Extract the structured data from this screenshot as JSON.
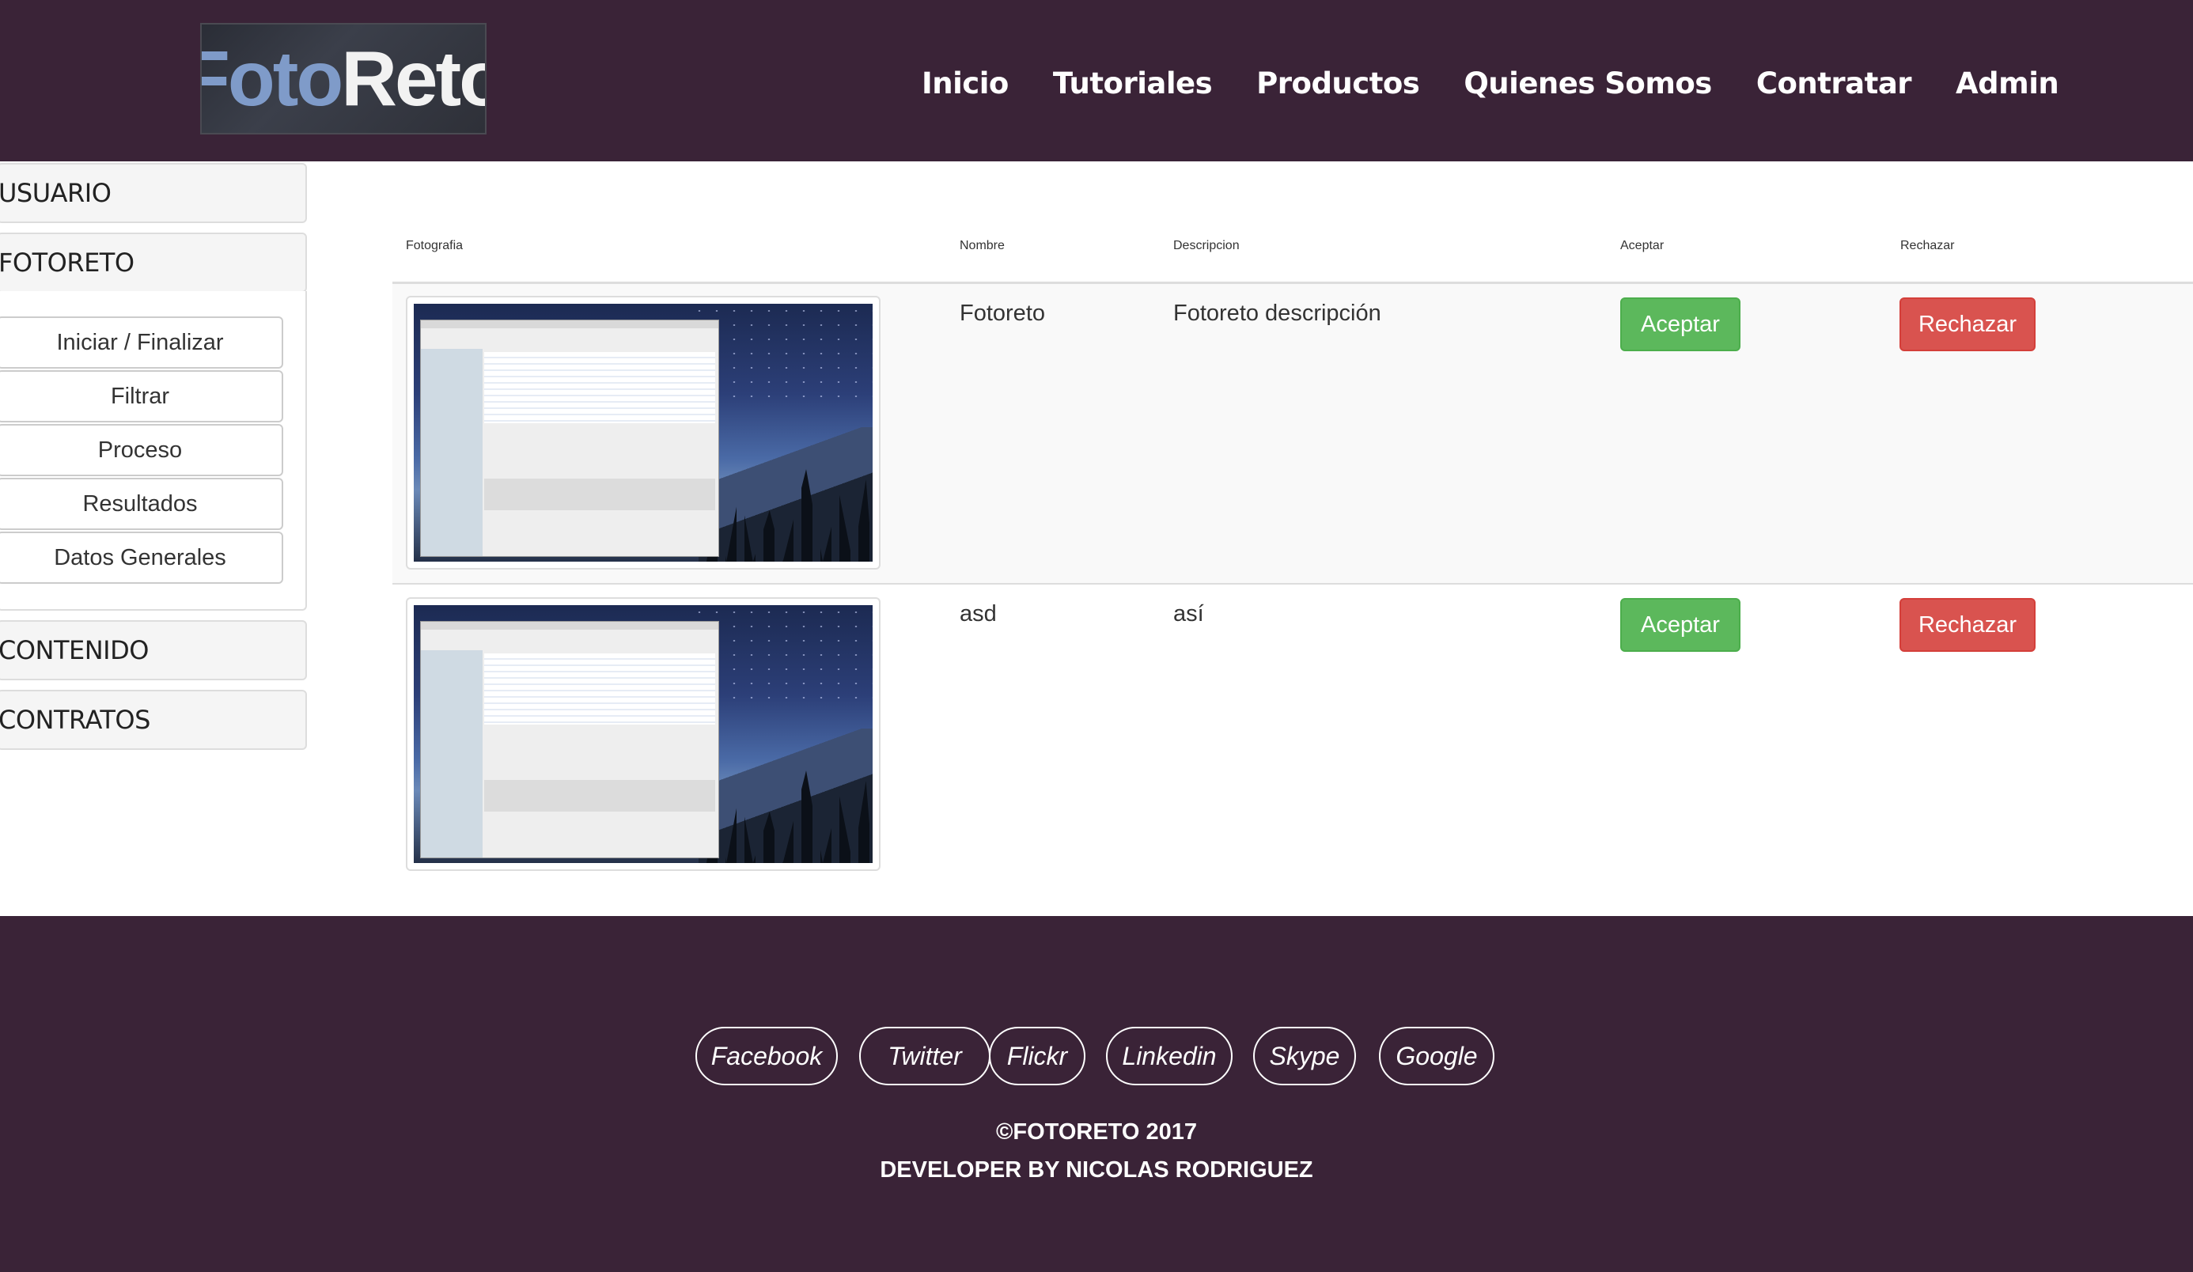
{
  "header": {
    "logo": {
      "part1": "Foto",
      "part2": "Reto"
    },
    "nav": [
      "Inicio",
      "Tutoriales",
      "Productos",
      "Quienes Somos",
      "Contratar",
      "Admin"
    ]
  },
  "sidebar": {
    "sections": [
      "USUARIO",
      "FOTORETO",
      "CONTENIDO",
      "CONTRATOS"
    ],
    "fotoreto_items": [
      "Iniciar / Finalizar",
      "Filtrar",
      "Proceso",
      "Resultados",
      "Datos Generales"
    ]
  },
  "table": {
    "headers": [
      "Fotografia",
      "Nombre",
      "Descripcion",
      "Aceptar",
      "Rechazar"
    ],
    "rows": [
      {
        "nombre": "Fotoreto",
        "descripcion": "Fotoreto descripción",
        "aceptar": "Aceptar",
        "rechazar": "Rechazar"
      },
      {
        "nombre": "asd",
        "descripcion": "así",
        "aceptar": "Aceptar",
        "rechazar": "Rechazar"
      }
    ]
  },
  "footer": {
    "social": [
      "Facebook",
      "Twitter",
      "Flickr",
      "Linkedin",
      "Skype",
      "Google"
    ],
    "copyright": "©FOTORETO 2017",
    "developer": "DEVELOPER BY NICOLAS RODRIGUEZ"
  },
  "colors": {
    "header_bg": "#3a2337",
    "accept": "#5cb85c",
    "reject": "#d9534f"
  }
}
